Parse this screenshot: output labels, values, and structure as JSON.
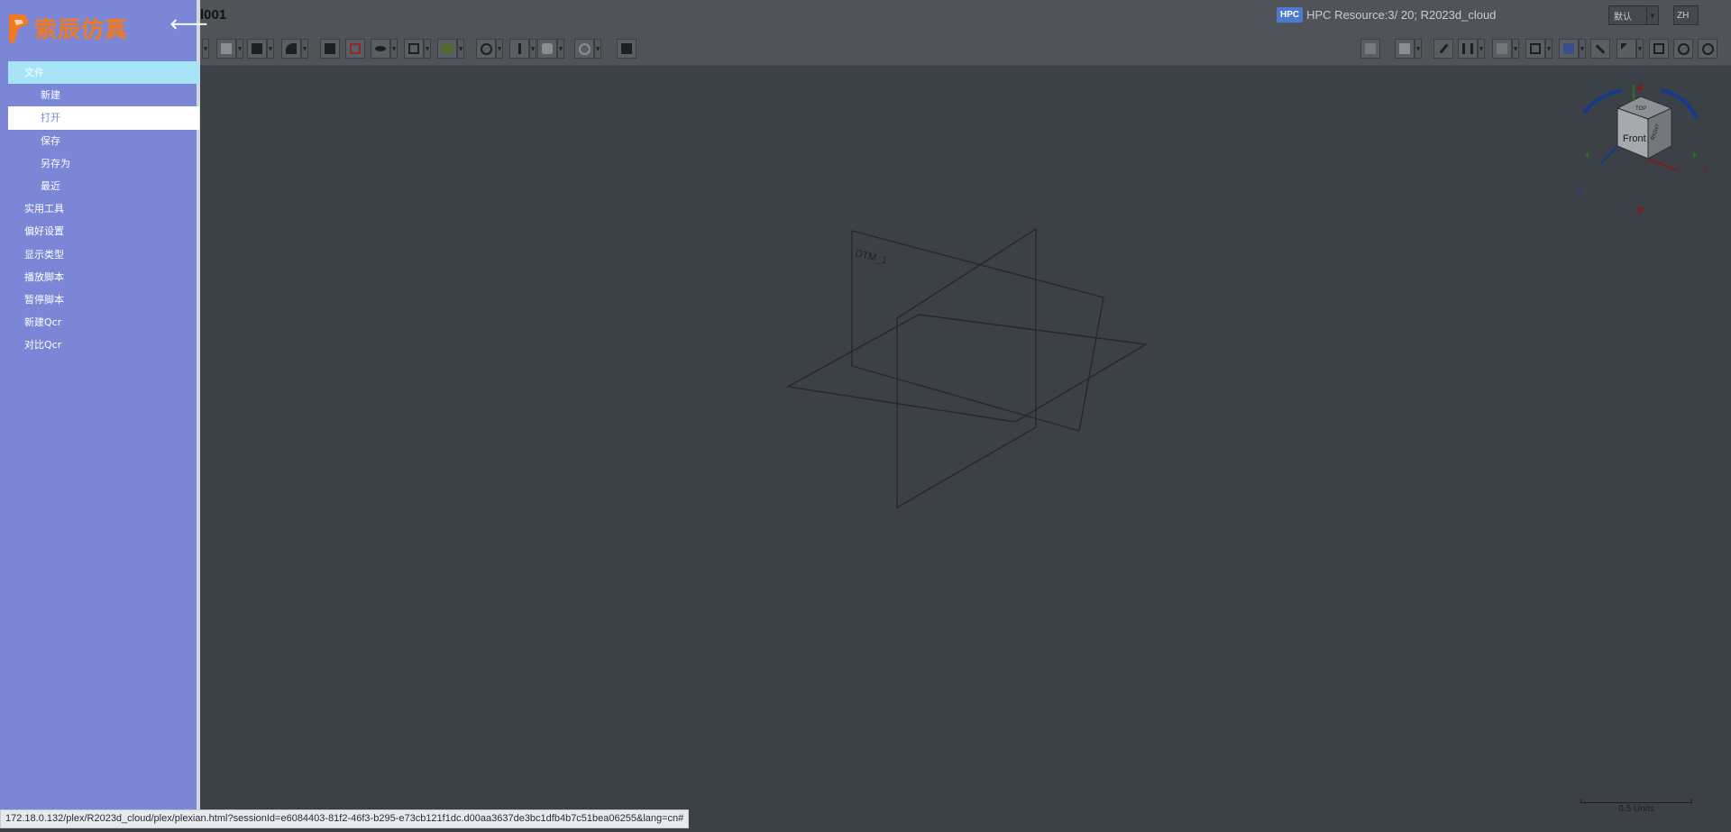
{
  "header": {
    "title": "l001",
    "hpc_badge": "HPC",
    "hpc_text": "HPC Resource:3/ 20; R2023d_cloud",
    "view_select": "默认",
    "lang_select": "ZH"
  },
  "sidebar": {
    "logo_text": "索辰仿真",
    "back_icon": "arrow-left-icon",
    "items": [
      {
        "label": "文件",
        "level": "top"
      },
      {
        "label": "新建",
        "level": "sub"
      },
      {
        "label": "打开",
        "level": "sub"
      },
      {
        "label": "保存",
        "level": "sub"
      },
      {
        "label": "另存为",
        "level": "sub"
      },
      {
        "label": "最近",
        "level": "sub"
      },
      {
        "label": "实用工具",
        "level": "top"
      },
      {
        "label": "偏好设置",
        "level": "top"
      },
      {
        "label": "显示类型",
        "level": "top"
      },
      {
        "label": "播放脚本",
        "level": "top"
      },
      {
        "label": "暂停脚本",
        "level": "top"
      },
      {
        "label": "新建Qcr",
        "level": "top"
      },
      {
        "label": "对比Qcr",
        "level": "top"
      }
    ]
  },
  "viewport": {
    "datum_label": "DTM_1",
    "cube_front": "Front",
    "cube_top": "TOP",
    "cube_right": "RIGHT",
    "axis_x": "x",
    "axis_z": "z",
    "scale_label": "0.5  Units"
  },
  "statusbar": {
    "url": "172.18.0.132/plex/R2023d_cloud/plex/plexian.html?sessionId=e6084403-81f2-46f3-b295-e73cb121f1dc.d00aa3637de3bc1dfb4b7c51bea06255&lang=cn#"
  },
  "colors": {
    "sidebar_bg": "#7b87d6",
    "sidebar_highlight": "#a8e4f7",
    "logo_orange": "#f07a22",
    "hpc_blue": "#4d79cf",
    "viewport_bg": "#3c4148"
  }
}
